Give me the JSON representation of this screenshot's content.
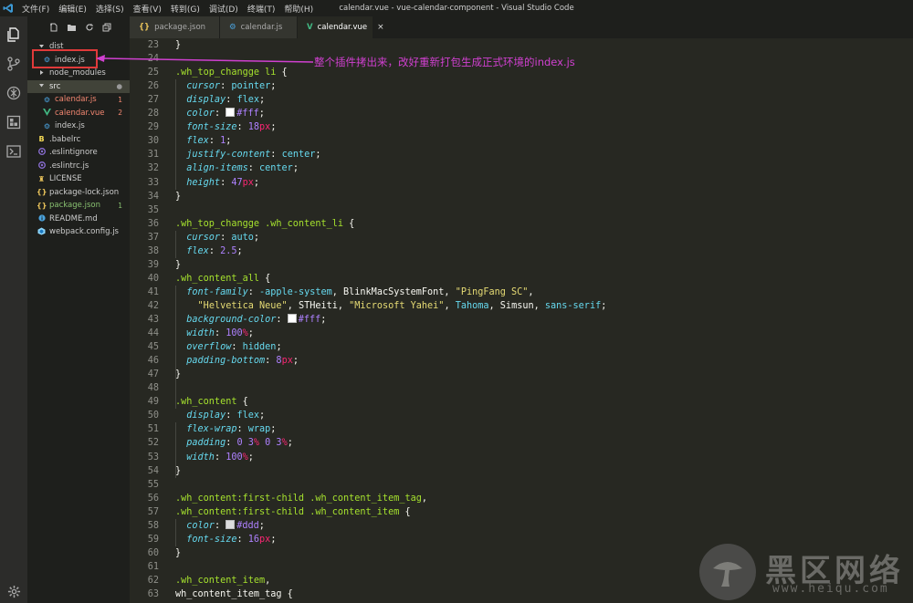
{
  "titlebar": {
    "window_title": "calendar.vue - vue-calendar-component - Visual Studio Code",
    "menu": [
      "文件(F)",
      "编辑(E)",
      "选择(S)",
      "查看(V)",
      "转到(G)",
      "调试(D)",
      "终端(T)",
      "帮助(H)"
    ]
  },
  "activity_bar": [
    "explorer-icon",
    "source-control-icon",
    "debug-icon",
    "extensions-icon",
    "terminal-icon",
    "settings-gear-icon"
  ],
  "explorer": {
    "toolbar": [
      "new-file-icon",
      "new-folder-icon",
      "refresh-icon",
      "collapse-all-icon"
    ],
    "tree": [
      {
        "label": "dist",
        "kind": "folder-open",
        "depth": 1,
        "color": "#cccccc"
      },
      {
        "label": "index.js",
        "kind": "vue-gear",
        "depth": 2,
        "color": "#cccccc",
        "selected": true
      },
      {
        "label": "node_modules",
        "kind": "folder-closed",
        "depth": 1,
        "color": "#cccccc"
      },
      {
        "label": "src",
        "kind": "folder-open",
        "depth": 1,
        "color": "#e6e6e6",
        "badge": "●",
        "badge_color": "#999999",
        "row_highlight": true
      },
      {
        "label": "calendar.js",
        "kind": "vue-gear",
        "depth": 2,
        "color": "#f48771",
        "badge": "1",
        "badge_color": "#f48771"
      },
      {
        "label": "calendar.vue",
        "kind": "vue",
        "depth": 2,
        "color": "#f48771",
        "badge": "2",
        "badge_color": "#f48771"
      },
      {
        "label": "index.js",
        "kind": "vue-gear",
        "depth": 2,
        "color": "#cccccc"
      },
      {
        "label": ".babelrc",
        "kind": "babel",
        "depth": 1,
        "color": "#cccccc"
      },
      {
        "label": ".eslintignore",
        "kind": "eslint",
        "depth": 1,
        "color": "#cccccc"
      },
      {
        "label": ".eslintrc.js",
        "kind": "eslint",
        "depth": 1,
        "color": "#cccccc"
      },
      {
        "label": "LICENSE",
        "kind": "license",
        "depth": 1,
        "color": "#cccccc"
      },
      {
        "label": "package-lock.json",
        "kind": "json",
        "depth": 1,
        "color": "#cccccc"
      },
      {
        "label": "package.json",
        "kind": "json",
        "depth": 1,
        "color": "#88c070",
        "badge": "1",
        "badge_color": "#88c070"
      },
      {
        "label": "README.md",
        "kind": "info",
        "depth": 1,
        "color": "#cccccc"
      },
      {
        "label": "webpack.config.js",
        "kind": "webpack",
        "depth": 1,
        "color": "#cccccc"
      }
    ]
  },
  "tabs": [
    {
      "label": "package.json",
      "icon": "{}",
      "icon_color": "#e8c25a",
      "active": false
    },
    {
      "label": "calendar.js",
      "icon": "⚙",
      "icon_color": "#4aa3df",
      "active": false
    },
    {
      "label": "calendar.vue",
      "icon": "V",
      "icon_color": "#41b883",
      "active": true,
      "close": "×"
    }
  ],
  "annotation": "整个插件拷出来，改好重新打包生成正式环境的index.js",
  "watermark": {
    "logo_text": "黑区网络",
    "url": "www.heiqu.com"
  },
  "code_lines": [
    {
      "n": "23",
      "t": [
        [
          "pun",
          "}"
        ]
      ]
    },
    {
      "n": "24",
      "t": []
    },
    {
      "n": "25",
      "t": [
        [
          "sel",
          ".wh_top_changge li"
        ],
        [
          "pun",
          " {"
        ]
      ]
    },
    {
      "n": "26",
      "t": [
        [
          "prop",
          "  cursor"
        ],
        [
          "pun",
          ": "
        ],
        [
          "val",
          "pointer"
        ],
        [
          "pun",
          ";"
        ]
      ]
    },
    {
      "n": "27",
      "t": [
        [
          "prop",
          "  display"
        ],
        [
          "pun",
          ": "
        ],
        [
          "val",
          "flex"
        ],
        [
          "pun",
          ";"
        ]
      ]
    },
    {
      "n": "28",
      "t": [
        [
          "prop",
          "  color"
        ],
        [
          "pun",
          ": "
        ],
        [
          "swatch",
          "#fff"
        ],
        [
          "num",
          "#fff"
        ],
        [
          "pun",
          ";"
        ]
      ]
    },
    {
      "n": "29",
      "t": [
        [
          "prop",
          "  font-size"
        ],
        [
          "pun",
          ": "
        ],
        [
          "num",
          "18"
        ],
        [
          "unit",
          "px"
        ],
        [
          "pun",
          ";"
        ]
      ]
    },
    {
      "n": "30",
      "t": [
        [
          "prop",
          "  flex"
        ],
        [
          "pun",
          ": "
        ],
        [
          "num",
          "1"
        ],
        [
          "pun",
          ";"
        ]
      ]
    },
    {
      "n": "31",
      "t": [
        [
          "prop",
          "  justify-content"
        ],
        [
          "pun",
          ": "
        ],
        [
          "val",
          "center"
        ],
        [
          "pun",
          ";"
        ]
      ]
    },
    {
      "n": "32",
      "t": [
        [
          "prop",
          "  align-items"
        ],
        [
          "pun",
          ": "
        ],
        [
          "val",
          "center"
        ],
        [
          "pun",
          ";"
        ]
      ]
    },
    {
      "n": "33",
      "t": [
        [
          "prop",
          "  height"
        ],
        [
          "pun",
          ": "
        ],
        [
          "num",
          "47"
        ],
        [
          "unit",
          "px"
        ],
        [
          "pun",
          ";"
        ]
      ]
    },
    {
      "n": "34",
      "t": [
        [
          "pun",
          "}"
        ]
      ]
    },
    {
      "n": "35",
      "t": []
    },
    {
      "n": "36",
      "t": [
        [
          "sel",
          ".wh_top_changge .wh_content_li"
        ],
        [
          "pun",
          " {"
        ]
      ]
    },
    {
      "n": "37",
      "t": [
        [
          "prop",
          "  cursor"
        ],
        [
          "pun",
          ": "
        ],
        [
          "val",
          "auto"
        ],
        [
          "pun",
          ";"
        ]
      ]
    },
    {
      "n": "38",
      "t": [
        [
          "prop",
          "  flex"
        ],
        [
          "pun",
          ": "
        ],
        [
          "num",
          "2.5"
        ],
        [
          "pun",
          ";"
        ]
      ]
    },
    {
      "n": "39",
      "t": [
        [
          "pun",
          "}"
        ]
      ]
    },
    {
      "n": "40",
      "t": [
        [
          "sel",
          ".wh_content_all"
        ],
        [
          "pun",
          " {"
        ]
      ]
    },
    {
      "n": "41",
      "t": [
        [
          "prop",
          "  font-family"
        ],
        [
          "pun",
          ": "
        ],
        [
          "val",
          "-apple-system"
        ],
        [
          "pun",
          ", BlinkMacSystemFont, "
        ],
        [
          "str",
          "\"PingFang SC\""
        ],
        [
          "pun",
          ","
        ]
      ]
    },
    {
      "n": "42",
      "t": [
        [
          "pun",
          "    "
        ],
        [
          "str",
          "\"Helvetica Neue\""
        ],
        [
          "pun",
          ", STHeiti, "
        ],
        [
          "str",
          "\"Microsoft Yahei\""
        ],
        [
          "pun",
          ", "
        ],
        [
          "val",
          "Tahoma"
        ],
        [
          "pun",
          ", Simsun, "
        ],
        [
          "val",
          "sans-serif"
        ],
        [
          "pun",
          ";"
        ]
      ]
    },
    {
      "n": "43",
      "t": [
        [
          "prop",
          "  background-color"
        ],
        [
          "pun",
          ": "
        ],
        [
          "swatch",
          "#fff"
        ],
        [
          "num",
          "#fff"
        ],
        [
          "pun",
          ";"
        ]
      ]
    },
    {
      "n": "44",
      "t": [
        [
          "prop",
          "  width"
        ],
        [
          "pun",
          ": "
        ],
        [
          "num",
          "100"
        ],
        [
          "unit",
          "%"
        ],
        [
          "pun",
          ";"
        ]
      ]
    },
    {
      "n": "45",
      "t": [
        [
          "prop",
          "  overflow"
        ],
        [
          "pun",
          ": "
        ],
        [
          "val",
          "hidden"
        ],
        [
          "pun",
          ";"
        ]
      ]
    },
    {
      "n": "46",
      "t": [
        [
          "prop",
          "  padding-bottom"
        ],
        [
          "pun",
          ": "
        ],
        [
          "num",
          "8"
        ],
        [
          "unit",
          "px"
        ],
        [
          "pun",
          ";"
        ]
      ]
    },
    {
      "n": "47",
      "t": [
        [
          "pun",
          "}"
        ]
      ]
    },
    {
      "n": "48",
      "t": []
    },
    {
      "n": "49",
      "t": [
        [
          "sel",
          ".wh_content"
        ],
        [
          "pun",
          " {"
        ]
      ]
    },
    {
      "n": "50",
      "t": [
        [
          "prop",
          "  display"
        ],
        [
          "pun",
          ": "
        ],
        [
          "val",
          "flex"
        ],
        [
          "pun",
          ";"
        ]
      ]
    },
    {
      "n": "51",
      "t": [
        [
          "prop",
          "  flex-wrap"
        ],
        [
          "pun",
          ": "
        ],
        [
          "val",
          "wrap"
        ],
        [
          "pun",
          ";"
        ]
      ]
    },
    {
      "n": "52",
      "t": [
        [
          "prop",
          "  padding"
        ],
        [
          "pun",
          ": "
        ],
        [
          "num",
          "0 3"
        ],
        [
          "unit",
          "%"
        ],
        [
          "num",
          " 0 3"
        ],
        [
          "unit",
          "%"
        ],
        [
          "pun",
          ";"
        ]
      ]
    },
    {
      "n": "53",
      "t": [
        [
          "prop",
          "  width"
        ],
        [
          "pun",
          ": "
        ],
        [
          "num",
          "100"
        ],
        [
          "unit",
          "%"
        ],
        [
          "pun",
          ";"
        ]
      ]
    },
    {
      "n": "54",
      "t": [
        [
          "pun",
          "}"
        ]
      ]
    },
    {
      "n": "55",
      "t": []
    },
    {
      "n": "56",
      "t": [
        [
          "sel",
          ".wh_content:first-child .wh_content_item_tag"
        ],
        [
          "pun",
          ","
        ]
      ]
    },
    {
      "n": "57",
      "t": [
        [
          "sel",
          ".wh_content:first-child .wh_content_item"
        ],
        [
          "pun",
          " {"
        ]
      ]
    },
    {
      "n": "58",
      "t": [
        [
          "prop",
          "  color"
        ],
        [
          "pun",
          ": "
        ],
        [
          "swatch",
          "#ddd"
        ],
        [
          "num",
          "#ddd"
        ],
        [
          "pun",
          ";"
        ]
      ]
    },
    {
      "n": "59",
      "t": [
        [
          "prop",
          "  font-size"
        ],
        [
          "pun",
          ": "
        ],
        [
          "num",
          "16"
        ],
        [
          "unit",
          "px"
        ],
        [
          "pun",
          ";"
        ]
      ]
    },
    {
      "n": "60",
      "t": [
        [
          "pun",
          "}"
        ]
      ]
    },
    {
      "n": "61",
      "t": []
    },
    {
      "n": "62",
      "t": [
        [
          "sel",
          ".wh_content_item"
        ],
        [
          "pun",
          ","
        ]
      ]
    },
    {
      "n": "63",
      "t": [
        [
          "pun",
          "wh_content_item_tag {"
        ]
      ]
    }
  ]
}
